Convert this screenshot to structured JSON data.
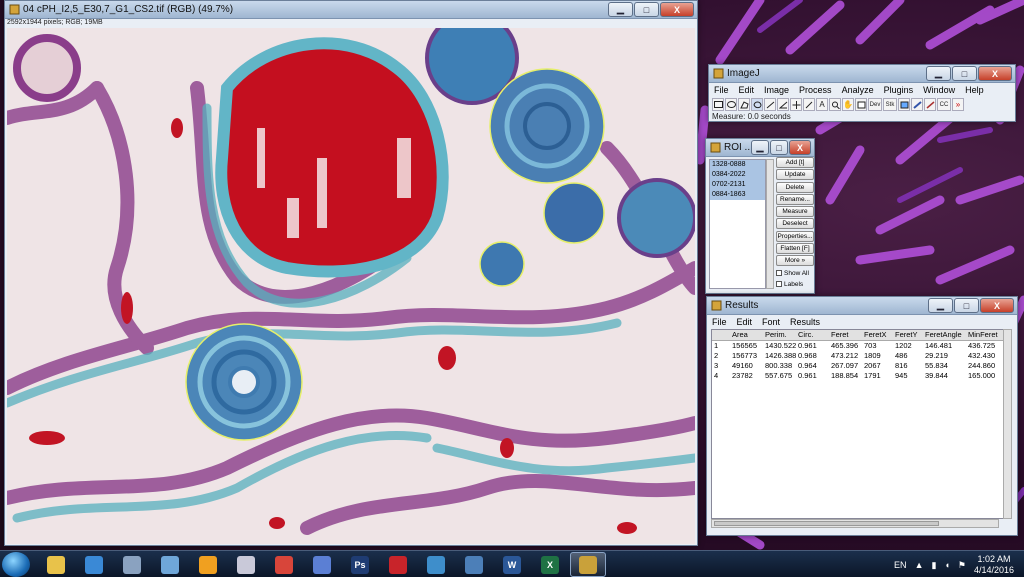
{
  "image_window": {
    "title": "04 cPH_I2,5_E30,7_G1_CS2.tif (RGB) (49.7%)",
    "info": "2592x1944 pixels; RGB; 19MB"
  },
  "imagej": {
    "title": "ImageJ",
    "menu": [
      "File",
      "Edit",
      "Image",
      "Process",
      "Analyze",
      "Plugins",
      "Window",
      "Help"
    ],
    "tools": [
      "rectangle-icon",
      "oval-icon",
      "polygon-icon",
      "freehand-icon",
      "line-icon",
      "angle-icon",
      "point-icon",
      "wand-icon",
      "text-icon",
      "magnifier-icon",
      "hand-icon",
      "color-picker-icon",
      "dev-icon",
      "stk-icon",
      "lut-icon",
      "brush-icon",
      "pencil-icon",
      "cc-icon",
      "more-icon"
    ],
    "tool_labels": {
      "dev": "Dev",
      "stk": "Stk",
      "cc": "CC",
      "more": "»"
    },
    "status": "Measure: 0.0 seconds"
  },
  "roi_manager": {
    "title": "ROI ...",
    "items": [
      "1328-0888",
      "0384-2022",
      "0702-2131",
      "0884-1863"
    ],
    "buttons": [
      "Add [t]",
      "Update",
      "Delete",
      "Rename...",
      "Measure",
      "Deselect",
      "Properties...",
      "Flatten [F]",
      "More »"
    ],
    "checkboxes": [
      "Show All",
      "Labels"
    ]
  },
  "results": {
    "title": "Results",
    "menu": [
      "File",
      "Edit",
      "Font",
      "Results"
    ],
    "columns": [
      "",
      "Area",
      "Perim.",
      "Circ.",
      "Feret",
      "FeretX",
      "FeretY",
      "FeretAngle",
      "MinFeret"
    ],
    "rows": [
      [
        "1",
        "156565",
        "1430.522",
        "0.961",
        "465.396",
        "703",
        "1202",
        "146.481",
        "436.725"
      ],
      [
        "2",
        "156773",
        "1426.388",
        "0.968",
        "473.212",
        "1809",
        "486",
        "29.219",
        "432.430"
      ],
      [
        "3",
        "49160",
        "800.338",
        "0.964",
        "267.097",
        "2067",
        "816",
        "55.834",
        "244.860"
      ],
      [
        "4",
        "23782",
        "557.675",
        "0.961",
        "188.854",
        "1791",
        "945",
        "39.844",
        "165.000"
      ]
    ]
  },
  "window_controls": {
    "minimize": "▁",
    "maximize": "□",
    "close": "X"
  },
  "taskbar": {
    "apps": [
      {
        "name": "file-explorer-icon",
        "label": "",
        "color": "#e8c24a"
      },
      {
        "name": "network-icon",
        "label": "",
        "color": "#3a89d6"
      },
      {
        "name": "calculator-icon",
        "label": "",
        "color": "#8aa2c0"
      },
      {
        "name": "document-icon",
        "label": "",
        "color": "#6fa7d9"
      },
      {
        "name": "orange-app-icon",
        "label": "",
        "color": "#f0a020"
      },
      {
        "name": "paint-icon",
        "label": "",
        "color": "#c9c9d9"
      },
      {
        "name": "chrome-icon",
        "label": "",
        "color": "#d8453a"
      },
      {
        "name": "butterfly-app-icon",
        "label": "",
        "color": "#5b7fd4"
      },
      {
        "name": "photoshop-icon",
        "label": "Ps",
        "color": "#1f3c73"
      },
      {
        "name": "acrobat-icon",
        "label": "",
        "color": "#c8242a"
      },
      {
        "name": "globe-app-icon",
        "label": "",
        "color": "#3e8ecb"
      },
      {
        "name": "image-viewer-icon",
        "label": "",
        "color": "#4c7fb8"
      },
      {
        "name": "word-icon",
        "label": "W",
        "color": "#2b5797"
      },
      {
        "name": "excel-icon",
        "label": "X",
        "color": "#1f7244"
      },
      {
        "name": "imagej-icon",
        "label": "",
        "color": "#c9a13a"
      }
    ],
    "language": "EN",
    "time": "1:02 AM",
    "date": "4/14/2016"
  }
}
